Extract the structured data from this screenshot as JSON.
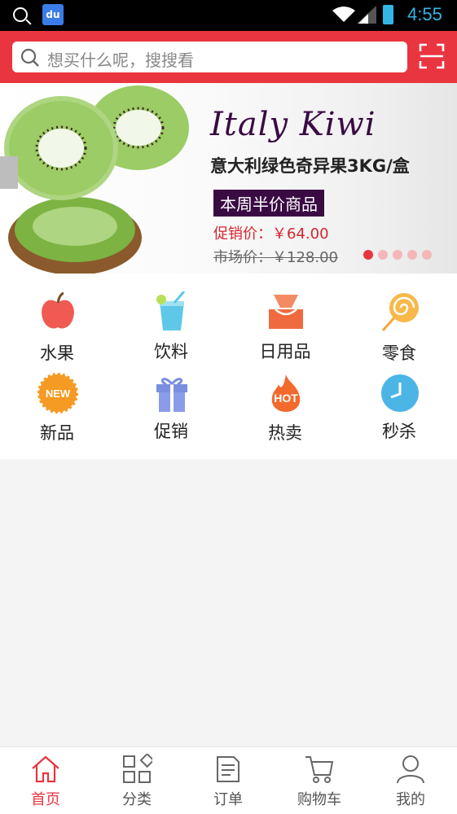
{
  "status_bar": {
    "time": "4:55",
    "app_badge": "du"
  },
  "search": {
    "placeholder": "想买什么呢，搜搜看"
  },
  "banner": {
    "title": "Italy Kiwi",
    "subtitle": "意大利绿色奇异果3KG/盒",
    "tag": "本周半价商品",
    "promo_price": "促销价：￥64.00",
    "market_price": "市场价：￥128.00",
    "slide_count": 5,
    "active_slide": 1
  },
  "categories": [
    {
      "label": "水果",
      "icon": "apple-icon"
    },
    {
      "label": "饮料",
      "icon": "drink-icon"
    },
    {
      "label": "日用品",
      "icon": "tissue-box-icon"
    },
    {
      "label": "零食",
      "icon": "lollipop-icon"
    },
    {
      "label": "新品",
      "icon": "new-badge-icon",
      "badge": "NEW"
    },
    {
      "label": "促销",
      "icon": "gift-icon"
    },
    {
      "label": "热卖",
      "icon": "hot-flame-icon",
      "badge": "HOT"
    },
    {
      "label": "秒杀",
      "icon": "clock-icon"
    }
  ],
  "tabs": [
    {
      "label": "首页",
      "icon": "home-icon",
      "active": true
    },
    {
      "label": "分类",
      "icon": "category-grid-icon",
      "active": false
    },
    {
      "label": "订单",
      "icon": "document-icon",
      "active": false
    },
    {
      "label": "购物车",
      "icon": "cart-icon",
      "active": false
    },
    {
      "label": "我的",
      "icon": "user-icon",
      "active": false
    }
  ],
  "colors": {
    "accent": "#e9353f",
    "banner_dark": "#3a0b43"
  }
}
